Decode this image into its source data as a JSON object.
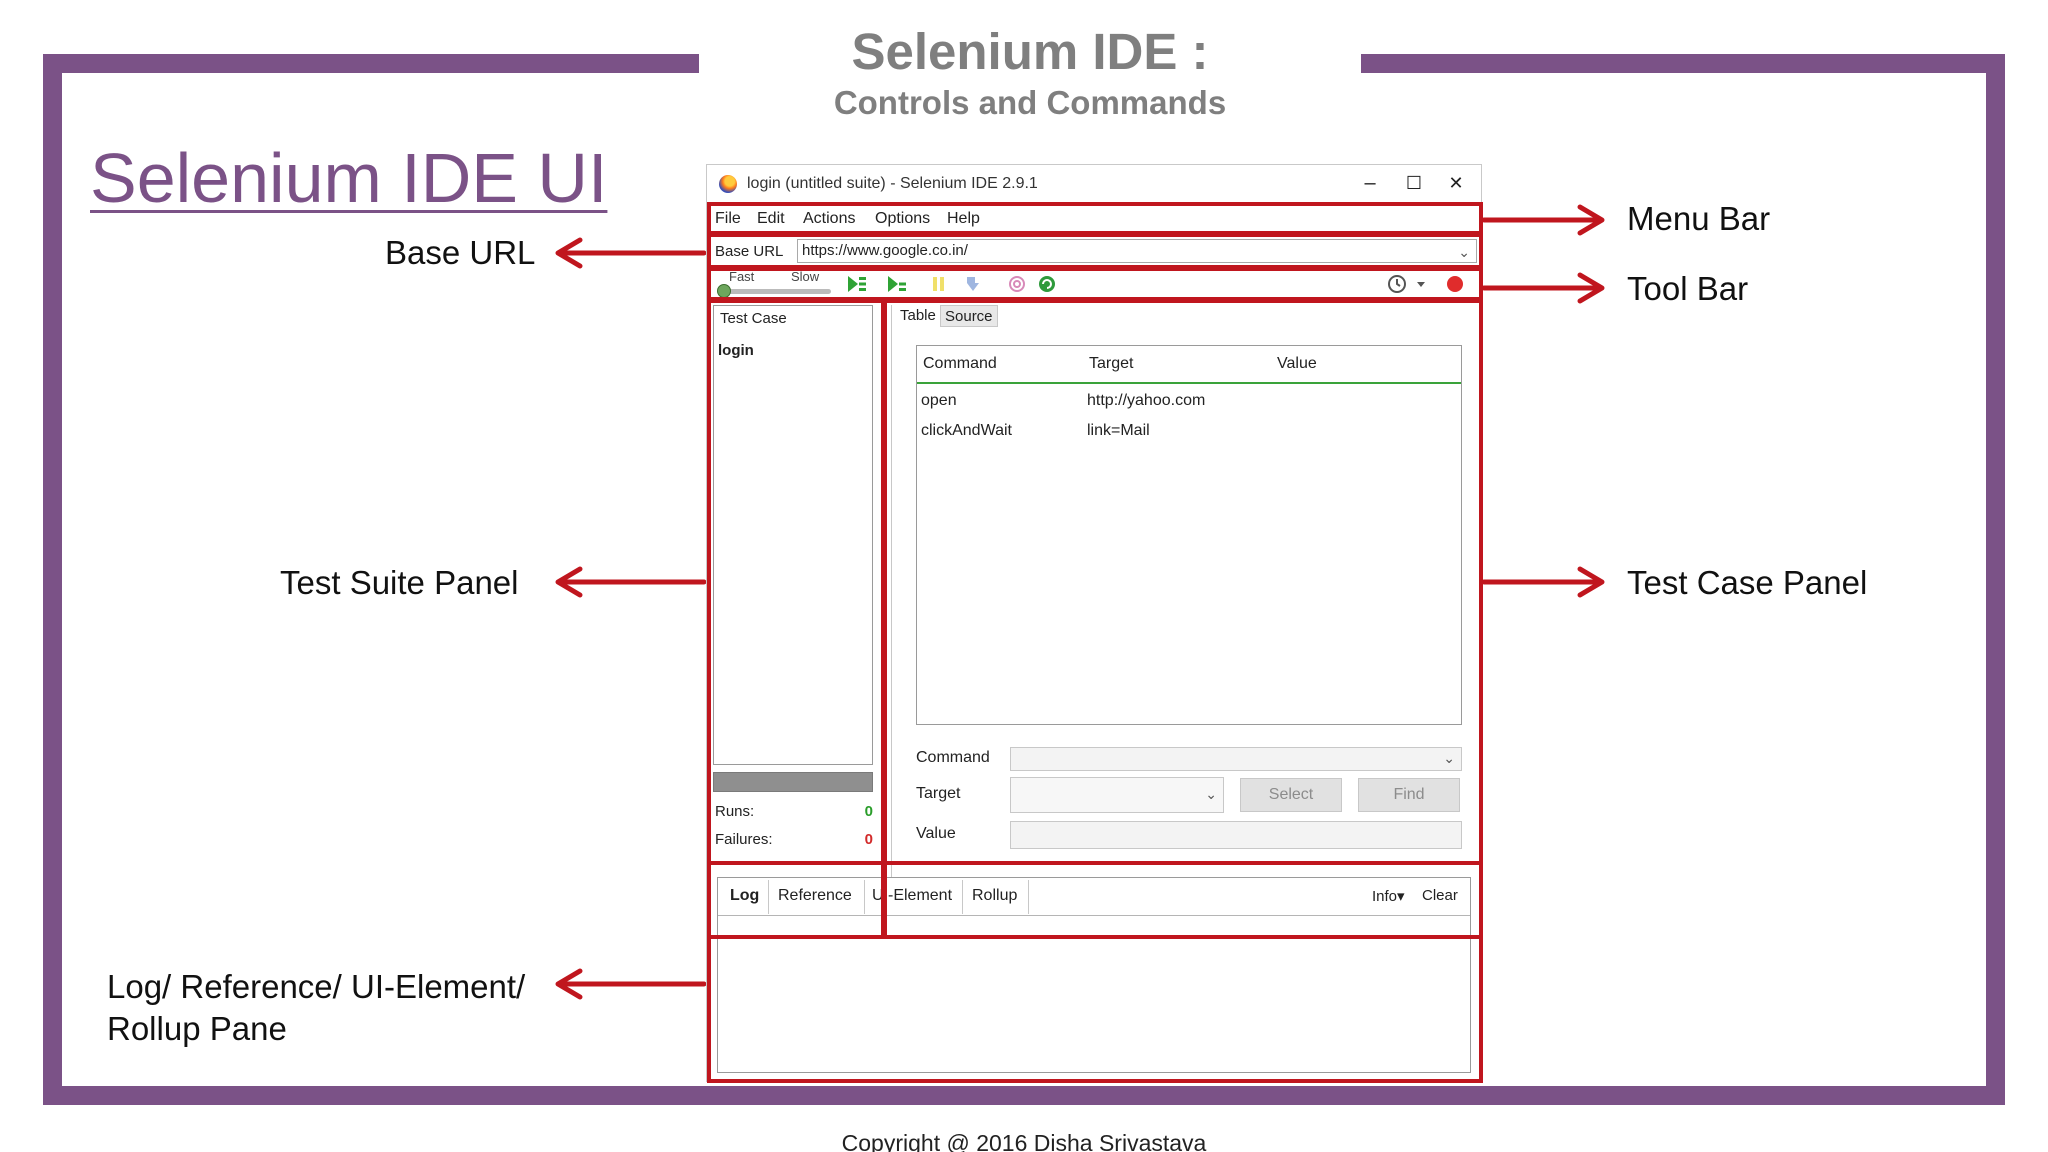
{
  "slide": {
    "title": "Selenium IDE :",
    "subtitle": "Controls and Commands",
    "section_title": "Selenium IDE UI",
    "copyright": "Copyright @ 2016 Disha Srivastava",
    "frame_color": "#7b5287",
    "highlight_color": "#c0161e"
  },
  "labels": {
    "menu_bar": "Menu Bar",
    "tool_bar": "Tool Bar",
    "base_url": "Base URL",
    "test_suite_panel": "Test Suite Panel",
    "test_case_panel": "Test Case Panel",
    "log_pane_line1": "Log/ Reference/ UI-Element/",
    "log_pane_line2": "Rollup Pane"
  },
  "ide": {
    "window_title": "login (untitled suite) - Selenium IDE 2.9.1",
    "window_buttons": [
      "–",
      "☐",
      "✕"
    ],
    "menu": [
      "File",
      "Edit",
      "Actions",
      "Options",
      "Help"
    ],
    "base_url_label": "Base URL",
    "base_url_value": "https://www.google.co.in/",
    "speed_fast": "Fast",
    "speed_slow": "Slow",
    "toolbar_icons": [
      "play-suite-icon",
      "play-test-icon",
      "pause-icon",
      "step-icon",
      "rollup-icon",
      "schedule-icon",
      "clock-icon",
      "dropdown-icon",
      "record-icon"
    ],
    "suite": {
      "header": "Test Case",
      "items": [
        "login"
      ],
      "runs_label": "Runs:",
      "runs_value": "0",
      "failures_label": "Failures:",
      "failures_value": "0"
    },
    "case": {
      "tabs": [
        "Table",
        "Source"
      ],
      "columns": [
        "Command",
        "Target",
        "Value"
      ],
      "rows": [
        {
          "command": "open",
          "target": "http://yahoo.com",
          "value": ""
        },
        {
          "command": "clickAndWait",
          "target": "link=Mail",
          "value": ""
        }
      ],
      "command_label": "Command",
      "target_label": "Target",
      "value_label": "Value",
      "select_button": "Select",
      "find_button": "Find"
    },
    "log": {
      "tabs": [
        "Log",
        "Reference",
        "UI-Element",
        "Rollup"
      ],
      "info_button": "Info▾",
      "clear_button": "Clear"
    }
  }
}
